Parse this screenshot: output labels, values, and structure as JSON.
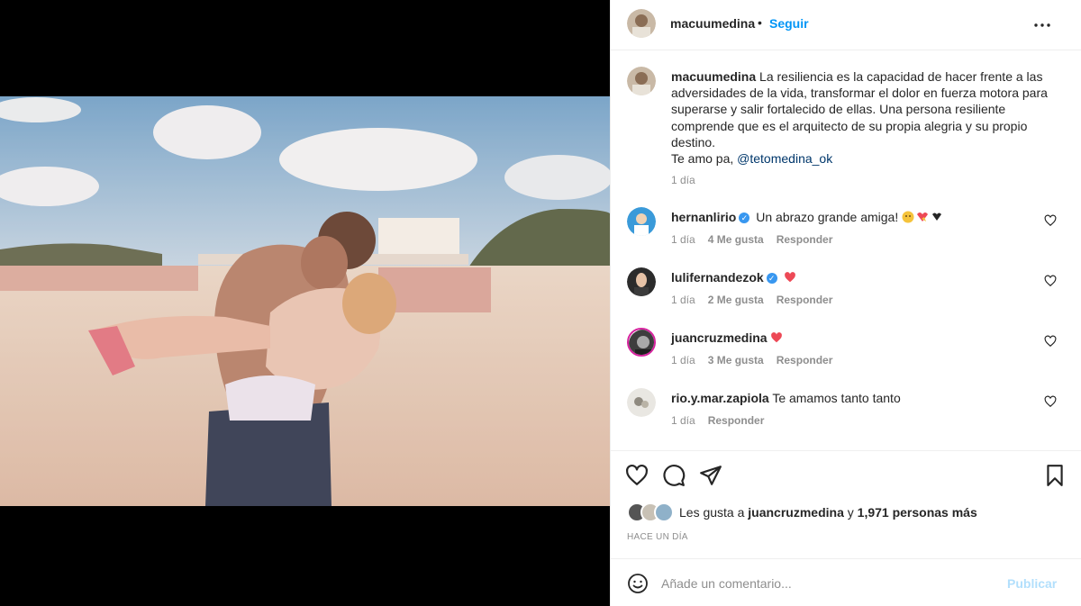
{
  "post": {
    "author": "macuumedina",
    "separator": "•",
    "follow_label": "Seguir",
    "caption_user": "macuumedina",
    "caption_text": "La resiliencia es la capacidad de hacer frente a las adversidades de la vida, transformar el dolor en fuerza motora para superarse y salir fortalecido de ellas. Una persona resiliente comprende que es el arquitecto de su propia alegria y su propio destino.",
    "caption_line2_prefix": "Te amo pa, ",
    "caption_mention": "@tetomedina_ok",
    "caption_time": "1 día"
  },
  "comments": [
    {
      "user": "hernanlirio",
      "verified": true,
      "text": "Un abrazo grande amiga!",
      "emoji": "hug-heart-emojis",
      "time": "1 día",
      "likes": "4 Me gusta",
      "reply": "Responder"
    },
    {
      "user": "lulifernandezok",
      "verified": true,
      "text": "",
      "emoji": "red-heart",
      "time": "1 día",
      "likes": "2 Me gusta",
      "reply": "Responder"
    },
    {
      "user": "juancruzmedina",
      "verified": false,
      "text": "",
      "emoji": "red-heart",
      "time": "1 día",
      "likes": "3 Me gusta",
      "reply": "Responder"
    },
    {
      "user": "rio.y.mar.zapiola",
      "verified": false,
      "text": "Te amamos tanto tanto",
      "emoji": "",
      "time": "1 día",
      "likes": "",
      "reply": "Responder"
    }
  ],
  "likes": {
    "prefix": "Les gusta a ",
    "user": "juancruzmedina",
    "middle": " y ",
    "count": "1,971 personas más"
  },
  "post_time": "HACE UN DÍA",
  "add_comment": {
    "placeholder": "Añade un comentario...",
    "publish_label": "Publicar"
  },
  "icons": {
    "more": "more-options-icon",
    "like": "heart-outline-icon",
    "comment": "comment-bubble-icon",
    "share": "paper-plane-icon",
    "save": "bookmark-icon",
    "emoji": "smiley-icon"
  },
  "colors": {
    "link_blue": "#0095f6",
    "mention_blue": "#00376b",
    "verified_blue": "#3897f0",
    "heart_red": "#ed4956",
    "muted_text": "#8e8e8e",
    "publish_disabled": "#b2dffc"
  }
}
